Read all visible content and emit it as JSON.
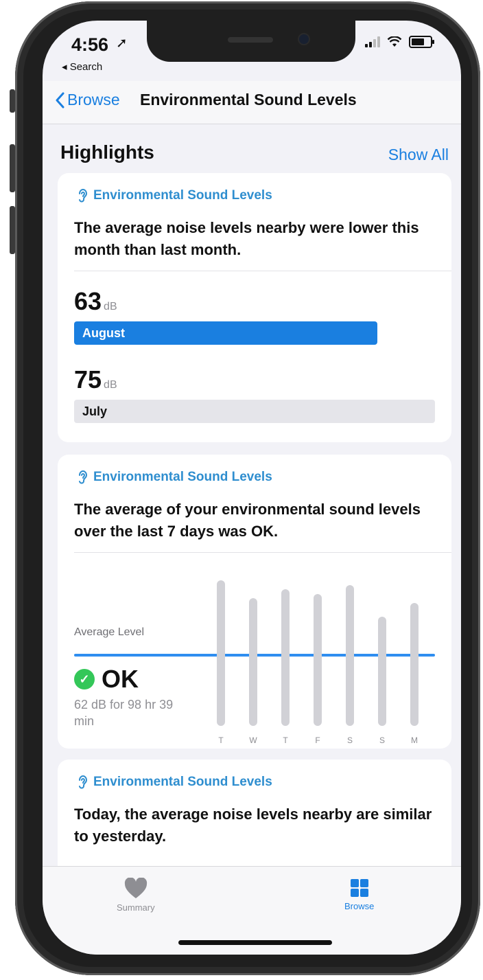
{
  "status": {
    "time": "4:56",
    "back_app": "◂ Search"
  },
  "nav": {
    "back_label": "Browse",
    "title": "Environmental Sound Levels"
  },
  "section": {
    "title": "Highlights",
    "show_all": "Show All"
  },
  "card1": {
    "category": "Environmental Sound Levels",
    "text": "The average noise levels nearby were lower this month than last month.",
    "current": {
      "value": "63",
      "unit": "dB",
      "label": "August"
    },
    "previous": {
      "value": "75",
      "unit": "dB",
      "label": "July"
    }
  },
  "card2": {
    "category": "Environmental Sound Levels",
    "text": "The average of your environmental sound levels over the last 7 days was OK.",
    "average_label": "Average Level",
    "status": "OK",
    "detail": "62 dB for 98 hr 39 min",
    "days": [
      "T",
      "W",
      "T",
      "F",
      "S",
      "S",
      "M"
    ]
  },
  "card3": {
    "category": "Environmental Sound Levels",
    "text": "Today, the average noise levels nearby are similar to yesterday."
  },
  "tabs": {
    "summary": "Summary",
    "browse": "Browse"
  },
  "colors": {
    "accent": "#1a7fe0",
    "ok_green": "#34c759",
    "august_bar": "#1a7fe0",
    "july_bar": "#e5e5ea"
  },
  "chart_data": {
    "type": "bar",
    "categories": [
      "T",
      "W",
      "T",
      "F",
      "S",
      "S",
      "M"
    ],
    "values": [
      72,
      68,
      70,
      69,
      71,
      64,
      67
    ],
    "average_level": 62,
    "ylim": [
      40,
      75
    ]
  }
}
